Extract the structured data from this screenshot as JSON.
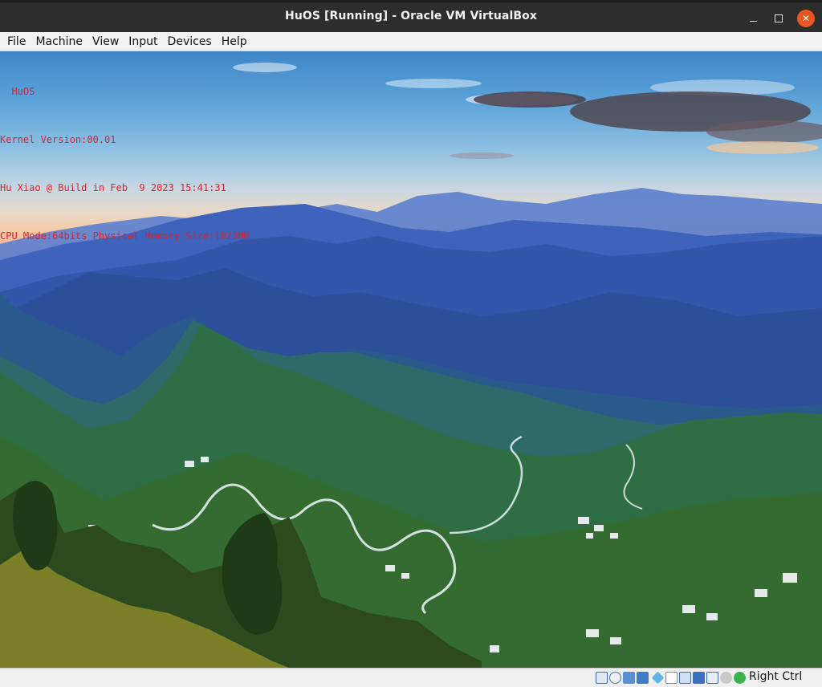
{
  "window": {
    "title": "HuOS [Running] - Oracle VM VirtualBox",
    "controls": {
      "minimize": "minimize-icon",
      "maximize": "maximize-icon",
      "close": "close-icon"
    },
    "accent_color": "#e95420"
  },
  "menu": {
    "items": [
      {
        "label": "File"
      },
      {
        "label": "Machine"
      },
      {
        "label": "View"
      },
      {
        "label": "Input"
      },
      {
        "label": "Devices"
      },
      {
        "label": "Help"
      }
    ]
  },
  "guest": {
    "background": "mountain-landscape-wallpaper",
    "console_color": "#e0202a",
    "console_lines": [
      "  HuOS",
      "Kernel Version:00.01",
      "Hu Xiao @ Build in Feb  9 2023 15:41:31",
      "CPU Mode:64bits Physical Memory Size:1023MB"
    ]
  },
  "statusbar": {
    "icons": [
      "hard-disk-icon",
      "optical-drive-icon",
      "audio-icon",
      "network-icon",
      "usb-icon",
      "shared-folders-icon",
      "display-icon",
      "recording-icon",
      "virtualization-icon",
      "mouse-integration-icon",
      "keyboard-capture-icon"
    ],
    "host_key": "Right Ctrl"
  }
}
